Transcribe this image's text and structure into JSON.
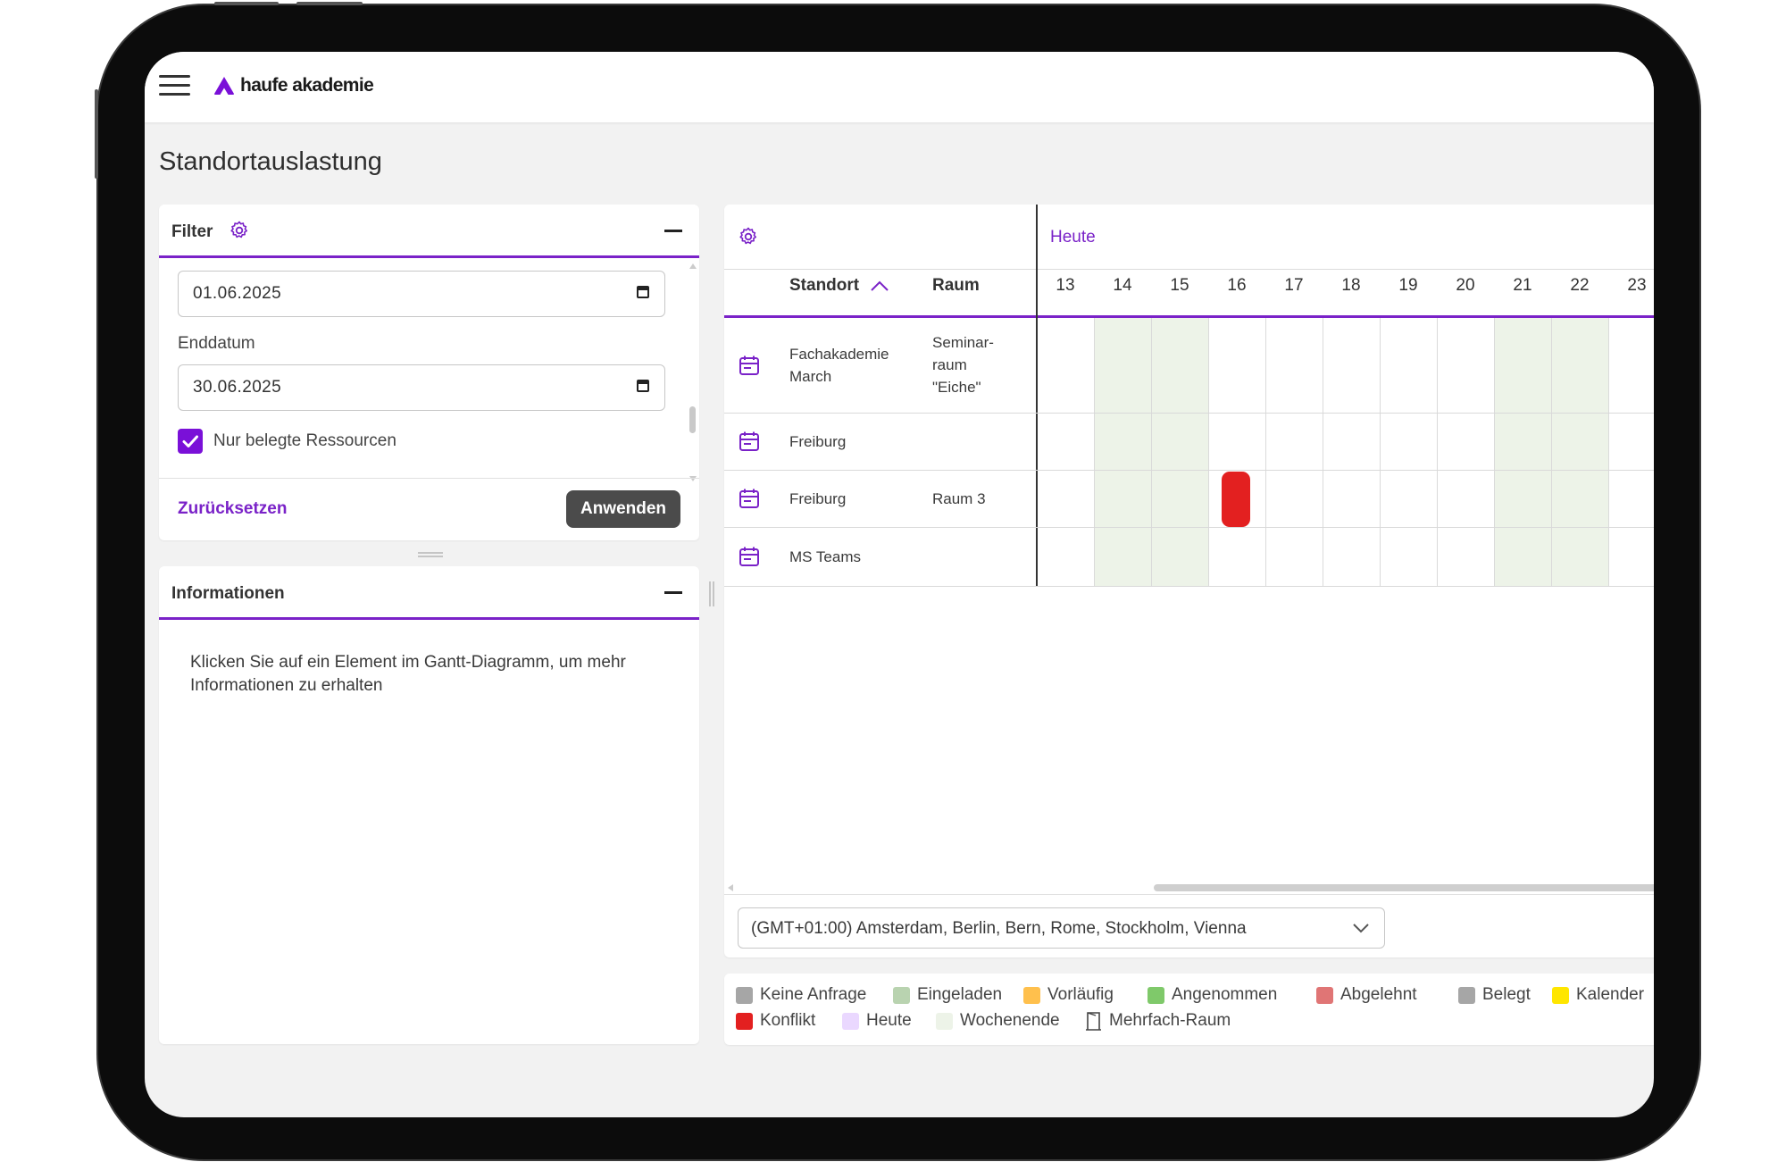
{
  "app": {
    "brand": "haufe akademie",
    "page_title": "Standortauslastung"
  },
  "filter": {
    "title": "Filter",
    "start_date": "01.06.2025",
    "end_label": "Enddatum",
    "end_date": "30.06.2025",
    "only_booked_label": "Nur belegte Ressourcen",
    "only_booked_checked": true,
    "reset_label": "Zurücksetzen",
    "apply_label": "Anwenden"
  },
  "info": {
    "title": "Informationen",
    "text": "Klicken Sie auf ein Element im Gantt-Diagramm, um mehr Informationen zu erhalten"
  },
  "gantt": {
    "today_label": "Heute",
    "col_location": "Standort",
    "col_room": "Raum",
    "days": [
      "13",
      "14",
      "15",
      "16",
      "17",
      "18",
      "19",
      "20",
      "21",
      "22",
      "23"
    ],
    "weekend_days": [
      "14",
      "15",
      "21",
      "22"
    ],
    "rows": [
      {
        "location": "Fachakademie March",
        "room": "Seminar-raum \"Eiche\""
      },
      {
        "location": "Freiburg",
        "room": ""
      },
      {
        "location": "Freiburg",
        "room": "Raum 3"
      },
      {
        "location": "MS Teams",
        "room": ""
      }
    ],
    "bookings": [
      {
        "row": 2,
        "day": "16",
        "status": "Konflikt",
        "color": "#e32020"
      }
    ],
    "timezone": "(GMT+01:00) Amsterdam, Berlin, Bern, Rome, Stockholm, Vienna"
  },
  "legend": {
    "items": [
      {
        "label": "Keine Anfrage",
        "color": "#a6a6a6"
      },
      {
        "label": "Eingeladen",
        "color": "#b9d3b0"
      },
      {
        "label": "Vorläufig",
        "color": "#ffc04d"
      },
      {
        "label": "Angenommen",
        "color": "#7fc96a"
      },
      {
        "label": "Abgelehnt",
        "color": "#e07575"
      },
      {
        "label": "Belegt",
        "color": "#a6a6a6"
      },
      {
        "label": "Kalender",
        "color": "#ffe600"
      },
      {
        "label": "Konflikt",
        "color": "#e32020"
      },
      {
        "label": "Heute",
        "color": "#ead8ff"
      },
      {
        "label": "Wochenende",
        "color": "#edf3e8"
      },
      {
        "label": "Mehrfach-Raum",
        "color": ""
      }
    ],
    "extra_color": "#4aa8f0"
  },
  "colors": {
    "accent": "#7a22c8",
    "dark_button": "#4b4b4b",
    "weekend": "#edf3e8"
  }
}
